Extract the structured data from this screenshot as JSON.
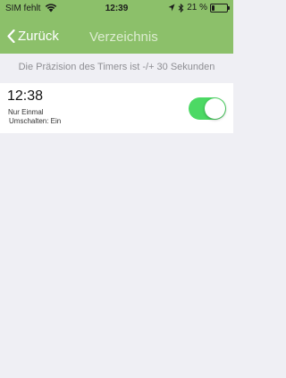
{
  "status_bar": {
    "carrier": "SIM fehlt",
    "time": "12:39",
    "battery_percent": "21 %",
    "battery_level": 0.21
  },
  "navbar": {
    "back_label": "Zurück",
    "title": "Verzeichnis"
  },
  "hint": "Die Präzision des Timers ist -/+ 30 Sekunden",
  "timers": [
    {
      "time": "12:38",
      "repeat": "Nur Einmal",
      "switch_label": "Umschalten: Ein",
      "enabled": true
    }
  ],
  "colors": {
    "header": "#8cc06a",
    "toggle_on": "#4cd964",
    "background": "#efeff4"
  }
}
